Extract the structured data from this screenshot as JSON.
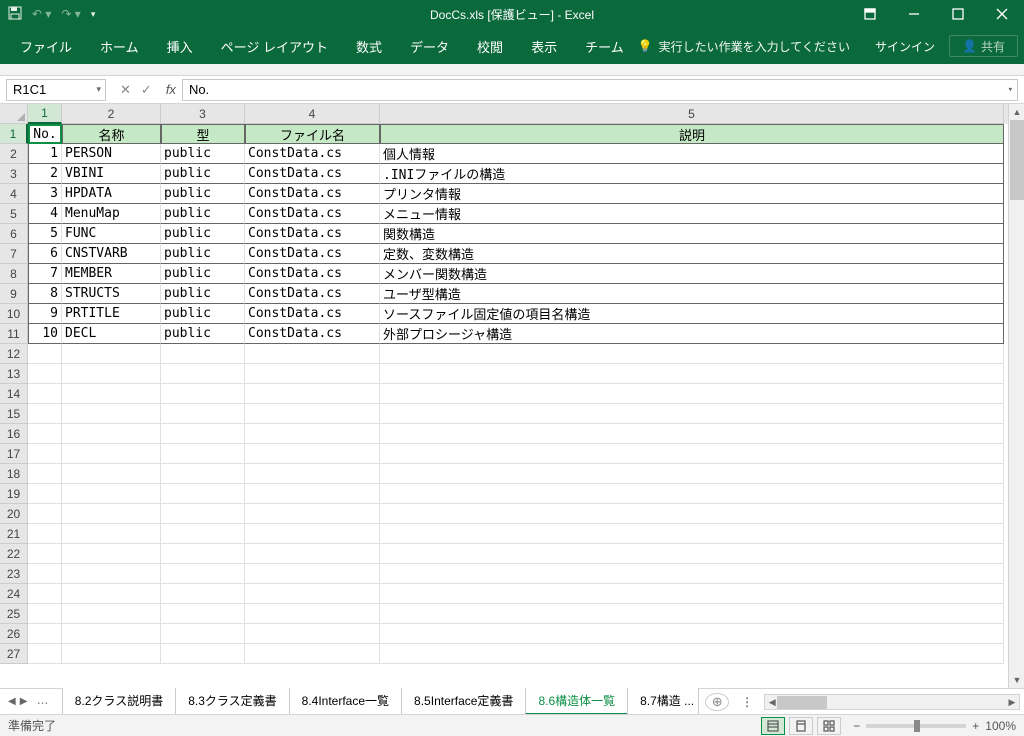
{
  "app": {
    "title": "DocCs.xls  [保護ビュー] - Excel",
    "signin": "サインイン",
    "share": "共有"
  },
  "ribbon": {
    "tabs": [
      "ファイル",
      "ホーム",
      "挿入",
      "ページ レイアウト",
      "数式",
      "データ",
      "校閲",
      "表示",
      "チーム"
    ],
    "tellme": "実行したい作業を入力してください"
  },
  "formula": {
    "namebox": "R1C1",
    "fx": "fx",
    "value": "No."
  },
  "columns": [
    "1",
    "2",
    "3",
    "4",
    "5"
  ],
  "headers": {
    "no": "No.",
    "name": "名称",
    "type": "型",
    "file": "ファイル名",
    "desc": "説明"
  },
  "rows": [
    {
      "n": "1",
      "no": "1",
      "name": "PERSON",
      "type": "public",
      "file": "ConstData.cs",
      "desc": "個人情報"
    },
    {
      "n": "2",
      "no": "2",
      "name": "VBINI",
      "type": "public",
      "file": "ConstData.cs",
      "desc": ".INIファイルの構造"
    },
    {
      "n": "3",
      "no": "3",
      "name": "HPDATA",
      "type": "public",
      "file": "ConstData.cs",
      "desc": "プリンタ情報"
    },
    {
      "n": "4",
      "no": "4",
      "name": "MenuMap",
      "type": "public",
      "file": "ConstData.cs",
      "desc": "メニュー情報"
    },
    {
      "n": "5",
      "no": "5",
      "name": "FUNC",
      "type": "public",
      "file": "ConstData.cs",
      "desc": "関数構造"
    },
    {
      "n": "6",
      "no": "6",
      "name": "CNSTVARB",
      "type": "public",
      "file": "ConstData.cs",
      "desc": "定数、変数構造"
    },
    {
      "n": "7",
      "no": "7",
      "name": "MEMBER",
      "type": "public",
      "file": "ConstData.cs",
      "desc": "メンバー関数構造"
    },
    {
      "n": "8",
      "no": "8",
      "name": "STRUCTS",
      "type": "public",
      "file": "ConstData.cs",
      "desc": "ユーザ型構造"
    },
    {
      "n": "9",
      "no": "9",
      "name": "PRTITLE",
      "type": "public",
      "file": "ConstData.cs",
      "desc": "ソースファイル固定値の項目名構造"
    },
    {
      "n": "10",
      "no": "10",
      "name": "DECL",
      "type": "public",
      "file": "ConstData.cs",
      "desc": "外部プロシージャ構造"
    }
  ],
  "emptyRows": [
    "12",
    "13",
    "14",
    "15",
    "16",
    "17",
    "18",
    "19",
    "20",
    "21",
    "22",
    "23",
    "24",
    "25",
    "26",
    "27"
  ],
  "sheets": {
    "tabs": [
      "8.2クラス説明書",
      "8.3クラス定義書",
      "8.4Interface一覧",
      "8.5Interface定義書",
      "8.6構造体一覧",
      "8.7構造 ..."
    ],
    "active": 4,
    "ellipsis": "..."
  },
  "status": {
    "ready": "準備完了",
    "zoom": "100%"
  }
}
